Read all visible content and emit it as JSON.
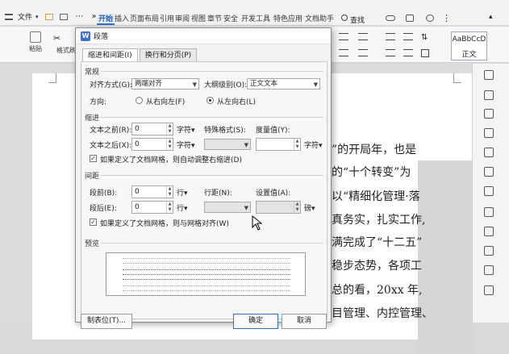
{
  "app": {
    "file_menu": "文件",
    "more_symbol": "»",
    "tabs": [
      "开始",
      "插入",
      "页面布局",
      "引用",
      "审阅",
      "视图",
      "章节",
      "安全",
      "开发工具",
      "特色应用",
      "文档助手"
    ],
    "search_label": "查找",
    "toolbar": {
      "paste_label": "粘贴",
      "format_painter_label": "格式刷",
      "style_preview": "AaBbCcD",
      "style_name": "正文"
    }
  },
  "document": {
    "lines": [
      "”的开局年，也是",
      "的“十个转变”为",
      "以“精细化管理·落",
      "真务实，扎实工作,",
      "满完成了“十二五”",
      "稳步态势，各项工",
      "总的看，20xx 年,",
      "目管理、内控管理、"
    ]
  },
  "dialog": {
    "title": "段落",
    "logo": "W",
    "tabs": [
      "缩进和间距(I)",
      "换行和分页(P)"
    ],
    "general": {
      "section": "常规",
      "alignment_label": "对齐方式(G):",
      "alignment_value": "两端对齐",
      "outline_label": "大纲级别(O):",
      "outline_value": "正文文本",
      "direction_label": "方向:",
      "rtl_label": "从右向左(F)",
      "ltr_label": "从左向右(L)",
      "direction_selected": "ltr"
    },
    "indent": {
      "section": "缩进",
      "before_label": "文本之前(R):",
      "before_value": "0",
      "before_unit": "字符▾",
      "after_label": "文本之后(X):",
      "after_value": "0",
      "after_unit": "字符▾",
      "special_label": "特殊格式(S):",
      "measure_label": "度量值(Y):",
      "measure_unit": "字符▾",
      "auto_adjust_label": "如果定义了文档网格，则自动调整右缩进(D)",
      "auto_adjust_checked": true
    },
    "spacing": {
      "section": "间距",
      "before_label": "段前(B):",
      "before_value": "0",
      "before_unit": "行▾",
      "after_label": "段后(E):",
      "after_value": "0",
      "after_unit": "行▾",
      "line_label": "行距(N):",
      "setting_label": "设置值(A):",
      "setting_unit": "磅▾",
      "grid_align_label": "如果定义了文档网格，则与网格对齐(W)",
      "grid_align_checked": true
    },
    "preview": {
      "section": "预览"
    },
    "buttons": {
      "tabs_button": "制表位(T)...",
      "ok": "确定",
      "cancel": "取消"
    }
  }
}
